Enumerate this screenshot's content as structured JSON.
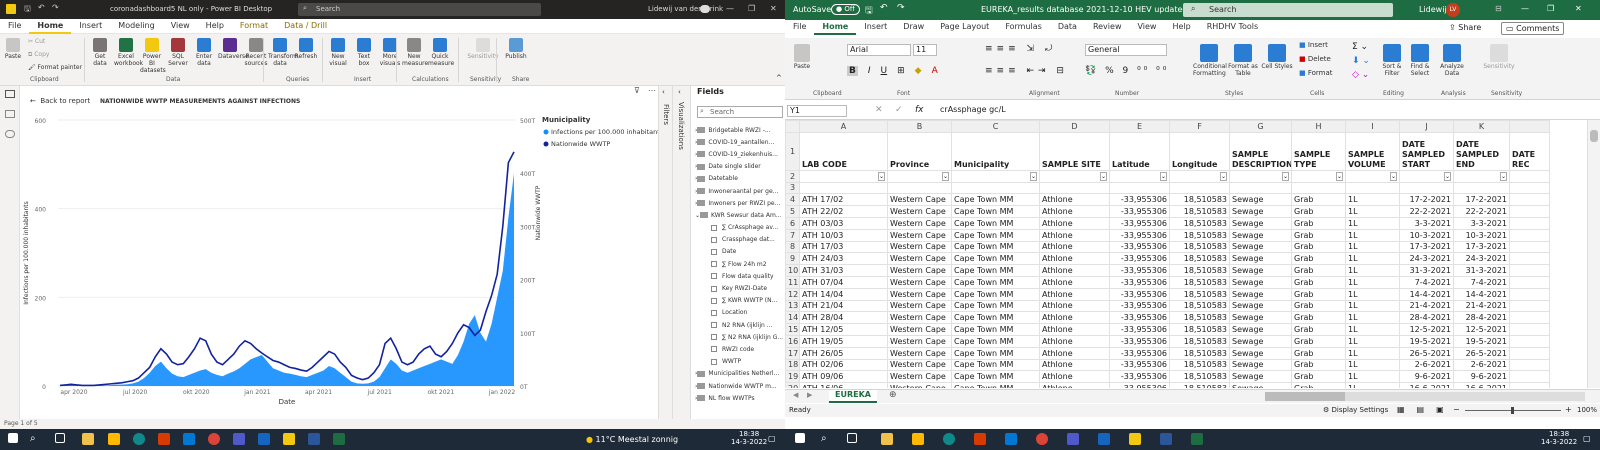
{
  "pbi": {
    "window_title": "coronadashboard5 NL only - Power BI Desktop",
    "search": "Search",
    "user": "Lidewij van den Brink",
    "menu": [
      "File",
      "Home",
      "Insert",
      "Modeling",
      "View",
      "Help",
      "Format",
      "Data / Drill"
    ],
    "clipboard": {
      "paste": "Paste",
      "cut": "Cut",
      "copy": "Copy",
      "format_painter": "Format painter",
      "group": "Clipboard"
    },
    "data_group": {
      "items": [
        "Get data",
        "Excel workbook",
        "Power BI datasets",
        "SQL Server",
        "Enter data",
        "Dataverse",
        "Recent sources"
      ],
      "group": "Data"
    },
    "queries": {
      "items": [
        "Transform data",
        "Refresh"
      ],
      "group": "Queries"
    },
    "insert": {
      "items": [
        "New visual",
        "Text box",
        "More visuals"
      ],
      "group": "Insert"
    },
    "calc": {
      "items": [
        "New measure",
        "Quick measure"
      ],
      "group": "Calculations"
    },
    "sensitivity": {
      "item": "Sensitivity",
      "group": "Sensitivity"
    },
    "share": {
      "item": "Publish",
      "group": "Share"
    },
    "back": "Back to report",
    "visual_title": "NATIONWIDE WWTP MEASUREMENTS AGAINST INFECTIONS",
    "page": "Page 1 of 5",
    "filters_pane": "Filters",
    "viz_pane": "Visualizations",
    "fields_title": "Fields",
    "fields_search": "Search",
    "fields": [
      {
        "t": "table",
        "n": "Bridgetable RWZI -..."
      },
      {
        "t": "table",
        "n": "COVID-19_aantallen..."
      },
      {
        "t": "table",
        "n": "COVID-19_ziekenhuis..."
      },
      {
        "t": "table",
        "n": "Date single slider"
      },
      {
        "t": "table",
        "n": "Datetable"
      },
      {
        "t": "table",
        "n": "Inwoneraantal per ge..."
      },
      {
        "t": "table",
        "n": "Inwoners per RWZI pe..."
      },
      {
        "t": "table",
        "n": "KWR Sewsur data Am..."
      },
      {
        "t": "field",
        "n": "∑ CrAssphage av..."
      },
      {
        "t": "field",
        "n": "Crassphage dat..."
      },
      {
        "t": "field",
        "n": "Date"
      },
      {
        "t": "field",
        "n": "∑ Flow 24h m2"
      },
      {
        "t": "field",
        "n": "Flow data quality"
      },
      {
        "t": "field",
        "n": "Key RWZI-Date"
      },
      {
        "t": "field",
        "n": "∑ KWR WWTP (N..."
      },
      {
        "t": "field",
        "n": "Location"
      },
      {
        "t": "field",
        "n": "N2 RNA (ijklijn ..."
      },
      {
        "t": "field",
        "n": "∑ N2 RNA (ijklijn G..."
      },
      {
        "t": "field",
        "n": "RWZI code"
      },
      {
        "t": "field",
        "n": "WWTP"
      },
      {
        "t": "table",
        "n": "Municipalities Netherl..."
      },
      {
        "t": "table",
        "n": "Nationwide WWTP m..."
      },
      {
        "t": "table",
        "n": "NL flow WWTPs"
      }
    ]
  },
  "chart_data": {
    "type": "line",
    "title": "NATIONWIDE WWTP MEASUREMENTS AGAINST INFECTIONS",
    "xlabel": "Date",
    "ylabel": "Infections per 100.000 inhabitants",
    "y2label": "Nationwide WWTP",
    "x_ticks": [
      "apr 2020",
      "jul 2020",
      "okt 2020",
      "jan 2021",
      "apr 2021",
      "jul 2021",
      "okt 2021",
      "jan 2022"
    ],
    "y_ticks": [
      "0",
      "200",
      "400",
      "600"
    ],
    "y2_ticks": [
      "0T",
      "100T",
      "200T",
      "300T",
      "400T",
      "500T"
    ],
    "ylim": [
      0,
      600
    ],
    "y2lim": [
      0,
      500
    ],
    "legend_title": "Municipality",
    "legend_position": "top-right",
    "series": [
      {
        "name": "Infections per 100.000 inhabitants",
        "kind": "area",
        "color": "#118dff",
        "values": [
          2,
          4,
          6,
          3,
          2,
          1,
          1,
          1,
          1,
          2,
          3,
          3,
          4,
          6,
          10,
          18,
          30,
          45,
          55,
          40,
          28,
          22,
          20,
          25,
          30,
          35,
          38,
          30,
          25,
          22,
          28,
          33,
          40,
          50,
          60,
          65,
          70,
          55,
          40,
          35,
          30,
          28,
          25,
          22,
          20,
          25,
          30,
          35,
          45,
          40,
          30,
          20,
          10,
          6,
          5,
          6,
          10,
          20,
          40,
          60,
          50,
          35,
          30,
          35,
          40,
          45,
          50,
          55,
          60,
          55,
          50,
          70,
          100,
          140,
          160,
          120,
          100,
          140,
          200,
          260,
          380,
          480
        ]
      },
      {
        "name": "Nationwide WWTP",
        "kind": "line",
        "color": "#12239e",
        "values": [
          1,
          2,
          3,
          2,
          1,
          1,
          1,
          2,
          3,
          4,
          5,
          6,
          8,
          10,
          15,
          25,
          35,
          55,
          70,
          60,
          45,
          40,
          42,
          55,
          70,
          90,
          85,
          60,
          45,
          40,
          50,
          60,
          75,
          85,
          80,
          70,
          62,
          55,
          48,
          45,
          40,
          35,
          33,
          30,
          28,
          35,
          45,
          55,
          65,
          60,
          45,
          35,
          20,
          15,
          12,
          15,
          25,
          40,
          80,
          90,
          70,
          45,
          40,
          45,
          60,
          70,
          75,
          60,
          55,
          65,
          80,
          100,
          115,
          110,
          95,
          105,
          140,
          170,
          210,
          300,
          420,
          440
        ]
      }
    ]
  },
  "xl": {
    "autosave": "AutoSave",
    "autosave_state": "Off",
    "file_title": "EUREKA_results database 2021-12-10 HEV updated.xlsx",
    "search": "Search",
    "user": "Lidewij",
    "initials": "LV",
    "menu": [
      "File",
      "Home",
      "Insert",
      "Draw",
      "Page Layout",
      "Formulas",
      "Data",
      "Review",
      "View",
      "Help",
      "RHDHV Tools"
    ],
    "share": "Share",
    "comments": "Comments",
    "font": "Arial",
    "size": "11",
    "numfmt": "General",
    "groups": [
      "Clipboard",
      "Font",
      "Alignment",
      "Number",
      "Styles",
      "Cells",
      "Editing",
      "Analysis",
      "Sensitivity"
    ],
    "styles_items": [
      "Conditional Formatting",
      "Format as Table",
      "Cell Styles"
    ],
    "cells_items": [
      "Insert",
      "Delete",
      "Format"
    ],
    "editing_items": [
      "Sort & Filter",
      "Find & Select"
    ],
    "analysis_item": "Analyze Data",
    "sens_item": "Sensitivity",
    "paste": "Paste",
    "cell_ref": "Y1",
    "formula": "crAssphage gc/L",
    "columns": [
      "A",
      "B",
      "C",
      "D",
      "E",
      "F",
      "G",
      "H",
      "I",
      "J",
      "K"
    ],
    "headers": [
      "LAB CODE",
      "Province",
      "Municipality",
      "SAMPLE SITE",
      "Latitude",
      "Longitude",
      "SAMPLE DESCRIPTION",
      "SAMPLE TYPE",
      "SAMPLE VOLUME",
      "DATE SAMPLED START",
      "DATE SAMPLED END",
      "DATE REC"
    ],
    "rows": [
      [
        "ATH 17/02",
        "17-2-2021",
        "17-2-2021"
      ],
      [
        "ATH 22/02",
        "22-2-2021",
        "22-2-2021"
      ],
      [
        "ATH 03/03",
        "3-3-2021",
        "3-3-2021"
      ],
      [
        "ATH 10/03",
        "10-3-2021",
        "10-3-2021"
      ],
      [
        "ATH 17/03",
        "17-3-2021",
        "17-3-2021"
      ],
      [
        "ATH 24/03",
        "24-3-2021",
        "24-3-2021"
      ],
      [
        "ATH 31/03",
        "31-3-2021",
        "31-3-2021"
      ],
      [
        "ATH 07/04",
        "7-4-2021",
        "7-4-2021"
      ],
      [
        "ATH 14/04",
        "14-4-2021",
        "14-4-2021"
      ],
      [
        "ATH 21/04",
        "21-4-2021",
        "21-4-2021"
      ],
      [
        "ATH 28/04",
        "28-4-2021",
        "28-4-2021"
      ],
      [
        "ATH 12/05",
        "12-5-2021",
        "12-5-2021"
      ],
      [
        "ATH 19/05",
        "19-5-2021",
        "19-5-2021"
      ],
      [
        "ATH 26/05",
        "26-5-2021",
        "26-5-2021"
      ],
      [
        "ATH 02/06",
        "2-6-2021",
        "2-6-2021"
      ],
      [
        "ATH 09/06",
        "9-6-2021",
        "9-6-2021"
      ],
      [
        "ATH 16/06",
        "16-6-2021",
        "16-6-2021"
      ]
    ],
    "row_const": {
      "province": "Western Cape",
      "muni": "Cape Town MM",
      "site": "Athlone",
      "lat": "-33,955306",
      "lon": "18,510583",
      "desc": "Sewage",
      "type": "Grab",
      "vol": "1L"
    },
    "sheet": "EUREKA",
    "status_ready": "Ready",
    "display_settings": "Display Settings",
    "zoom": "100%"
  },
  "taskbar": {
    "weather": "11°C  Meestal zonnig",
    "time": "18:38",
    "date": "14-3-2022"
  }
}
